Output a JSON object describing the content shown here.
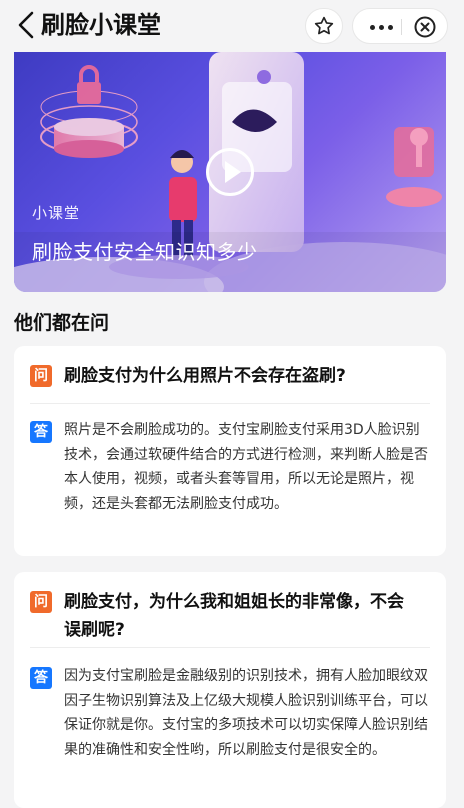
{
  "header": {
    "title": "刷脸小课堂"
  },
  "banner": {
    "subtitle": "小课堂",
    "title": "刷脸支付安全知识知多少"
  },
  "section": {
    "title": "他们都在问"
  },
  "qa": [
    {
      "q_badge": "问",
      "question": "刷脸支付为什么用照片不会存在盗刷?",
      "a_badge": "答",
      "answer": "照片是不会刷脸成功的。支付宝刷脸支付采用3D人脸识别技术，会通过软硬件结合的方式进行检测，来判断人脸是否本人使用，视频，或者头套等冒用，所以无论是照片，视频，还是头套都无法刷脸支付成功。"
    },
    {
      "q_badge": "问",
      "question": "刷脸支付，为什么我和姐姐长的非常像，不会误刷呢?",
      "a_badge": "答",
      "answer": "因为支付宝刷脸是金融级别的识别技术，拥有人脸加眼纹双因子生物识别算法及上亿级大规模人脸识别训练平台，可以保证你就是你。支付宝的多项技术可以切实保障人脸识别结果的准确性和安全性哟，所以刷脸支付是很安全的。"
    }
  ]
}
